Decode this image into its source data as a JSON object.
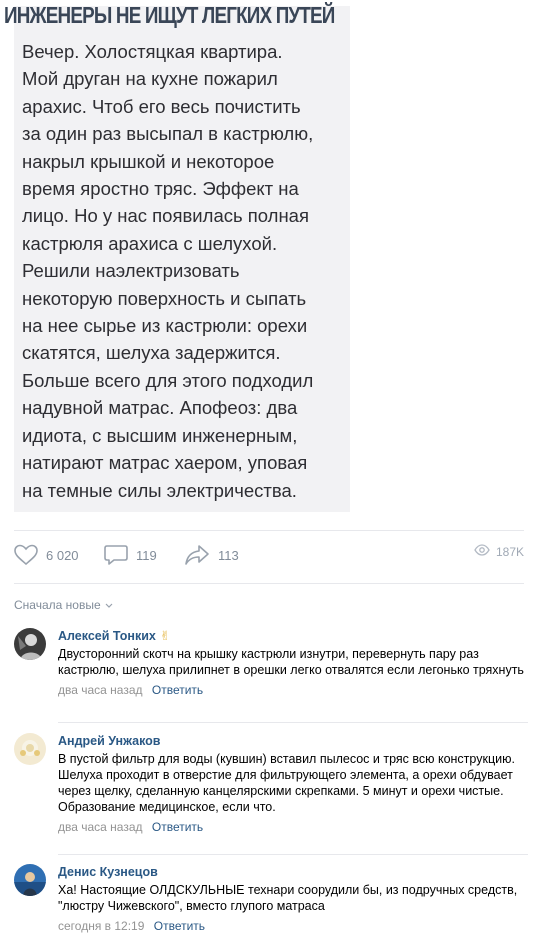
{
  "post": {
    "headline": "ИНЖЕНЕРЫ НЕ ИЩУТ ЛЕГКИХ ПУТЕЙ",
    "story_lines": [
      "Вечер. Холостяцкая квартира.",
      "Мой друган на кухне пожарил",
      "арахис. Чтоб его весь почистить",
      "за один раз высыпал в кастрюлю,",
      "накрыл крышкой и некоторое",
      "время яростно тряс. Эффект на",
      "лицо. Но у нас появилась полная",
      "кастрюля арахиса с шелухой.",
      "Решили наэлектризовать",
      "некоторую поверхность и сыпать",
      "на нее сырье из кастрюли: орехи",
      "скатятся, шелуха задержится.",
      "Больше всего для этого подходил",
      "надувной матрас. Апофеоз: два",
      "идиота, с высшим инженерным,",
      "натирают матрас хаером, уповая",
      "на темные силы электричества."
    ]
  },
  "actions": {
    "likes": "6 020",
    "comments": "119",
    "shares": "113",
    "views": "187K",
    "like_icon": "heart-icon",
    "comment_icon": "speech-bubble-icon",
    "share_icon": "share-arrow-icon",
    "views_icon": "eye-icon"
  },
  "sort_label": "Сначала новые",
  "comments": [
    {
      "author": "Алексей Тонких",
      "badge": "✌",
      "text": "Двусторонний скотч на крышку кастрюли изнутри, перевернуть пару раз кастрюлю, шелуха прилипнет в орешки легко отвалятся если легонько тряхнуть",
      "time": "два часа назад",
      "reply": "Ответить"
    },
    {
      "author": "Андрей Унжаков",
      "text": "В пустой фильтр для воды (кувшин) вставил пылесос и тряс всю конструкцию. Шелуха проходит в отверстие для фильтрующего элемента, а орехи обдувает через щелку, сделанную канцелярскими скрепками. 5 минут и орехи чистые.",
      "text2": "Образование медицинское, если что.",
      "time": "два часа назад",
      "reply": "Ответить"
    },
    {
      "author": "Денис Кузнецов",
      "text": "Ха! Настоящие ОЛДСКУЛЬНЫЕ технари соорудили бы, из подручных средств, \"люстру Чижевского\", вместо глупого матраса",
      "time": "сегодня в 12:19",
      "reply": "Ответить"
    }
  ],
  "colors": {
    "link": "#2a5885",
    "muted": "#818c99",
    "divider": "#e7e8ec",
    "headline": "#3a4657"
  }
}
